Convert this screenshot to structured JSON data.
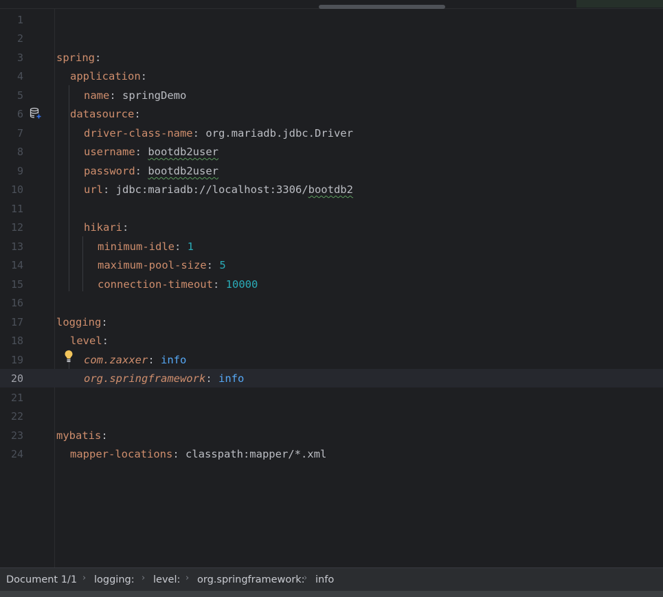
{
  "editor": {
    "current_line": "20",
    "line_numbers": [
      "1",
      "2",
      "3",
      "4",
      "5",
      "6",
      "7",
      "8",
      "9",
      "10",
      "11",
      "12",
      "13",
      "14",
      "15",
      "16",
      "17",
      "18",
      "19",
      "20",
      "21",
      "22",
      "23",
      "24"
    ],
    "lines": {
      "l3": {
        "key": "spring",
        "colon": ":"
      },
      "l4": {
        "key": "application",
        "colon": ":"
      },
      "l5": {
        "key": "name",
        "colon": ": ",
        "value": "springDemo"
      },
      "l6": {
        "key": "datasource",
        "colon": ":"
      },
      "l7": {
        "key": "driver-class-name",
        "colon": ": ",
        "value": "org.mariadb.jdbc.Driver"
      },
      "l8": {
        "key": "username",
        "colon": ": ",
        "value": "bootdb2user"
      },
      "l9": {
        "key": "password",
        "colon": ": ",
        "value": "bootdb2user"
      },
      "l10": {
        "key": "url",
        "colon": ": ",
        "value_a": "jdbc:mariadb://localhost:3306/",
        "value_b": "bootdb2"
      },
      "l12": {
        "key": "hikari",
        "colon": ":"
      },
      "l13": {
        "key": "minimum-idle",
        "colon": ": ",
        "value": "1"
      },
      "l14": {
        "key": "maximum-pool-size",
        "colon": ": ",
        "value": "5"
      },
      "l15": {
        "key": "connection-timeout",
        "colon": ": ",
        "value": "10000"
      },
      "l17": {
        "key": "logging",
        "colon": ":"
      },
      "l18": {
        "key": "level",
        "colon": ":"
      },
      "l19": {
        "key": "com.zaxxer",
        "colon": ": ",
        "value": "info"
      },
      "l20": {
        "key": "org.springframework",
        "colon": ": ",
        "value": "info"
      },
      "l23": {
        "key": "mybatis",
        "colon": ":"
      },
      "l24": {
        "key": "mapper-locations",
        "colon": ": ",
        "value": "classpath:mapper/*.xml"
      }
    }
  },
  "icons": {
    "gutter_line6": "database-icon",
    "intention_line19": "lightbulb-icon"
  },
  "statusbar": {
    "breadcrumbs": [
      "Document 1/1",
      "logging:",
      "level:",
      "org.springframework:",
      "info"
    ],
    "separator": "›"
  },
  "colors": {
    "background": "#1e1f22",
    "key": "#cf8e6d",
    "number": "#2aacb8",
    "keyword_value": "#56a8f5",
    "text": "#bcbec4",
    "current_line": "#26282e"
  }
}
